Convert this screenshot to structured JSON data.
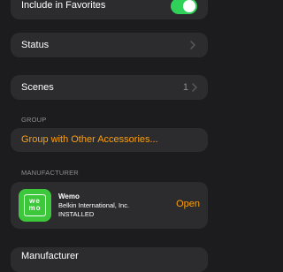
{
  "favorites": {
    "label": "Include in Favorites",
    "toggle_on": true
  },
  "status": {
    "label": "Status"
  },
  "scenes": {
    "label": "Scenes",
    "count": "1"
  },
  "group": {
    "header": "GROUP",
    "action": "Group with Other Accessories..."
  },
  "manufacturer_section": {
    "header": "MANUFACTURER",
    "app_name": "Wemo",
    "company": "Belkin International, Inc.",
    "status": "INSTALLED",
    "open_label": "Open",
    "logo_text": "wemo"
  },
  "manufacturer_row": {
    "label": "Manufacturer"
  },
  "colors": {
    "accent": "#ff9f0a",
    "toggle_green": "#30d158",
    "wemo_green": "#3cc83a"
  }
}
